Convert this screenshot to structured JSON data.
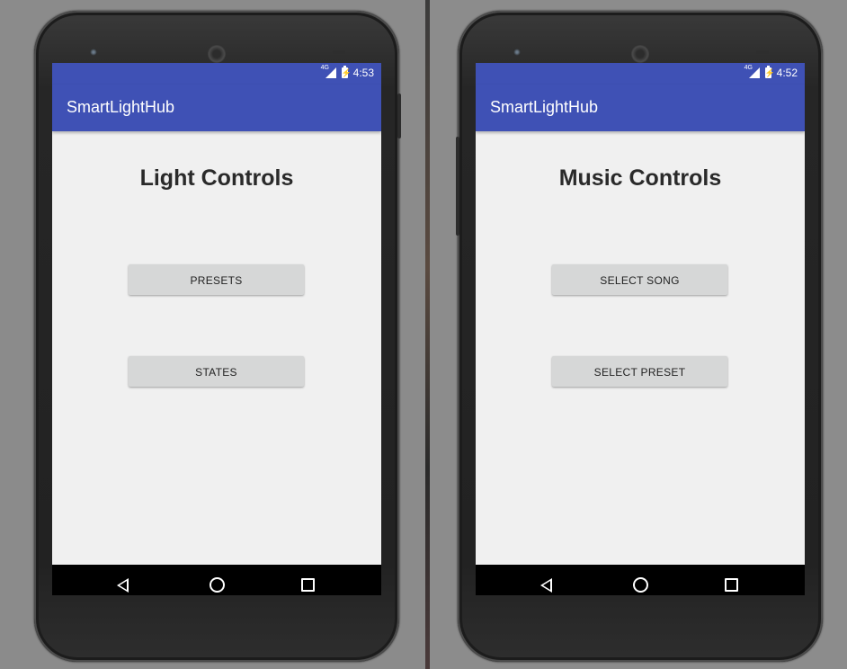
{
  "screens": [
    {
      "status_time": "4:53",
      "network": "4G",
      "app_title": "SmartLightHub",
      "page_title": "Light Controls",
      "buttons": [
        "PRESETS",
        "STATES"
      ]
    },
    {
      "status_time": "4:52",
      "network": "4G",
      "app_title": "SmartLightHub",
      "page_title": "Music Controls",
      "buttons": [
        "SELECT SONG",
        "SELECT PRESET"
      ]
    }
  ],
  "colors": {
    "app_bar": "#3f51b5",
    "screen_background": "#f0f0f0",
    "button": "#d6d7d7",
    "nav_bar": "#000000"
  },
  "icons": [
    "signal-icon",
    "battery-icon",
    "back-icon",
    "home-icon",
    "recents-icon"
  ]
}
